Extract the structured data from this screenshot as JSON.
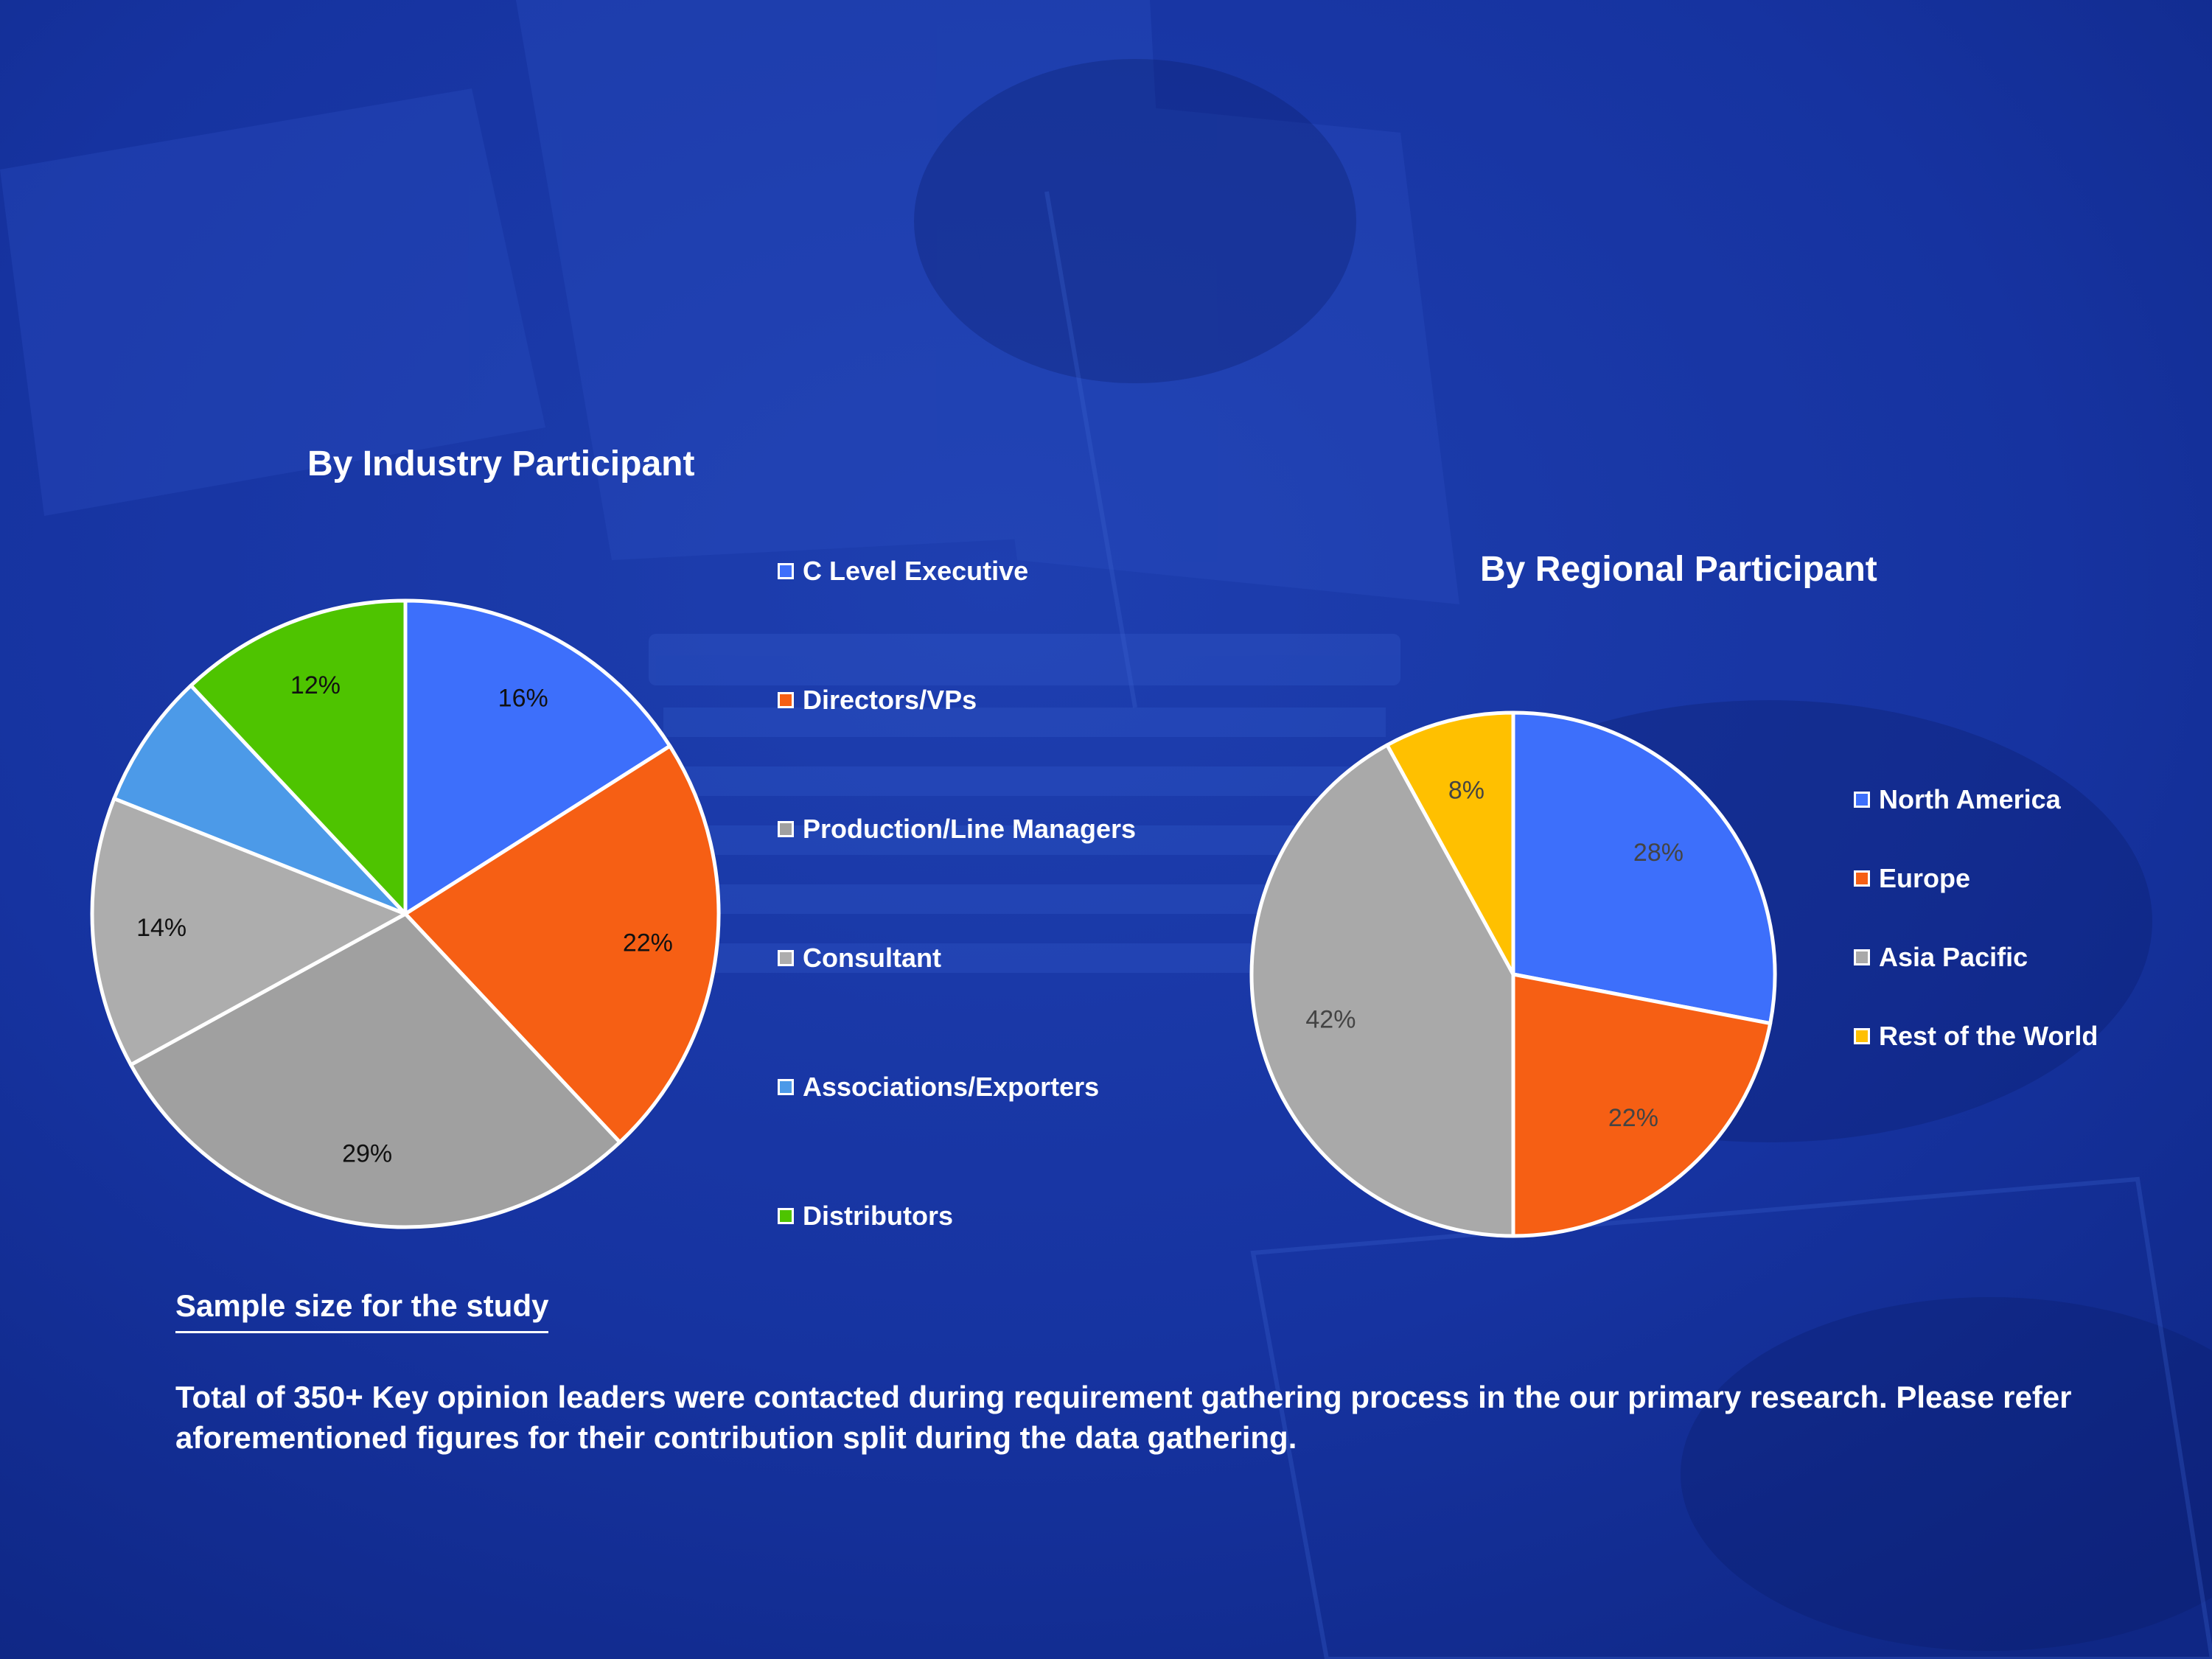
{
  "colors": {
    "background": "#14309a",
    "blue": "#3d6ffb",
    "orange": "#f65f14",
    "dark_gray": "#a0a0a0",
    "gray": "#adadad",
    "light_blue": "#4c9ae8",
    "green": "#4ec400",
    "yellow": "#ffc000",
    "slice_border": "#ffffff"
  },
  "chart_data": [
    {
      "type": "pie",
      "title": "By Industry Participant",
      "start_angle_deg": 0,
      "direction": "clockwise",
      "legend_position": "right",
      "slices": [
        {
          "label": "C Level Executive",
          "value": 16,
          "value_label": "16%",
          "color": "#3d6ffb"
        },
        {
          "label": "Directors/VPs",
          "value": 22,
          "value_label": "22%",
          "color": "#f65f14"
        },
        {
          "label": "Production/Line Managers",
          "value": 29,
          "value_label": "29%",
          "color": "#a0a0a0"
        },
        {
          "label": "Consultant",
          "value": 14,
          "value_label": "14%",
          "color": "#adadad"
        },
        {
          "label": "Associations/Exporters",
          "value": 7,
          "value_label": "",
          "color": "#4c9ae8"
        },
        {
          "label": "Distributors",
          "value": 12,
          "value_label": "12%",
          "color": "#4ec400"
        }
      ]
    },
    {
      "type": "pie",
      "title": "By Regional Participant",
      "start_angle_deg": 0,
      "direction": "clockwise",
      "legend_position": "right",
      "slices": [
        {
          "label": "North America",
          "value": 28,
          "value_label": "28%",
          "color": "#3d6ffb"
        },
        {
          "label": "Europe",
          "value": 22,
          "value_label": "22%",
          "color": "#f65f14"
        },
        {
          "label": "Asia Pacific",
          "value": 42,
          "value_label": "42%",
          "color": "#a9a9a9"
        },
        {
          "label": "Rest of the World",
          "value": 8,
          "value_label": "8%",
          "color": "#ffc000"
        }
      ]
    }
  ],
  "sample": {
    "heading": "Sample size for the study",
    "body": "Total of 350+ Key opinion leaders  were contacted during requirement gathering process in the our primary research. Please refer aforementioned figures for their contribution split during the data gathering."
  }
}
